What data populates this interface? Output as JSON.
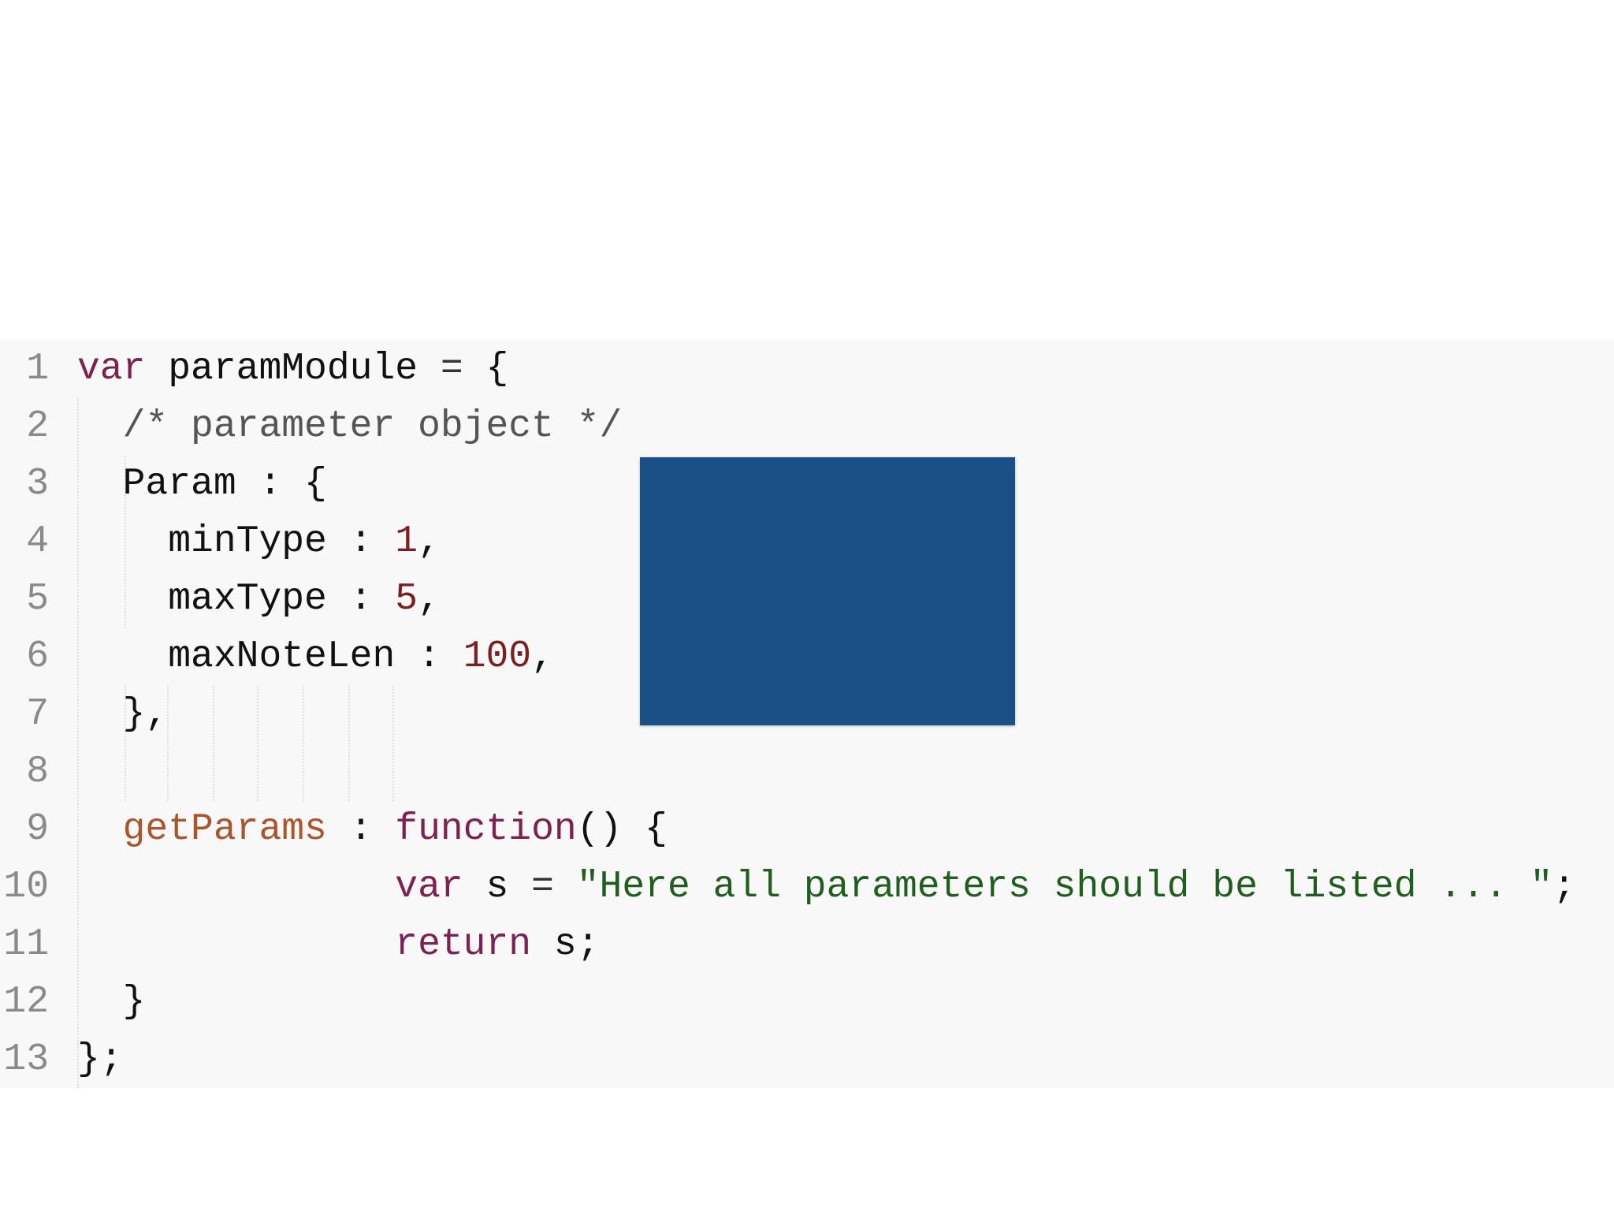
{
  "colors": {
    "background": "#ffffff",
    "editor_background": "#f8f8f8",
    "gutter_text": "#8a8a8a",
    "default_text": "#111111",
    "keyword": "#7c2150",
    "property": "#a9562e",
    "number": "#7b2020",
    "comment": "#555555",
    "string": "#1f5e1f",
    "punctuation": "#333333",
    "redaction_block": "#1a5086"
  },
  "editor": {
    "lines": [
      {
        "number": "1",
        "tokens": [
          {
            "text": "var",
            "type": "keyword"
          },
          {
            "text": " paramModule ",
            "type": "plain"
          },
          {
            "text": "=",
            "type": "punctuation"
          },
          {
            "text": " {",
            "type": "plain"
          }
        ]
      },
      {
        "number": "2",
        "tokens": [
          {
            "text": "  ",
            "type": "plain"
          },
          {
            "text": "/* parameter object */",
            "type": "comment"
          }
        ]
      },
      {
        "number": "3",
        "tokens": [
          {
            "text": "  Param : {",
            "type": "plain"
          }
        ]
      },
      {
        "number": "4",
        "tokens": [
          {
            "text": "    minType : ",
            "type": "plain"
          },
          {
            "text": "1",
            "type": "number"
          },
          {
            "text": ",",
            "type": "plain"
          }
        ]
      },
      {
        "number": "5",
        "tokens": [
          {
            "text": "    maxType : ",
            "type": "plain"
          },
          {
            "text": "5",
            "type": "number"
          },
          {
            "text": ",",
            "type": "plain"
          }
        ]
      },
      {
        "number": "6",
        "tokens": [
          {
            "text": "    maxNoteLen : ",
            "type": "plain"
          },
          {
            "text": "100",
            "type": "number"
          },
          {
            "text": ",",
            "type": "plain"
          }
        ]
      },
      {
        "number": "7",
        "tokens": [
          {
            "text": "  },",
            "type": "plain"
          }
        ]
      },
      {
        "number": "8",
        "tokens": []
      },
      {
        "number": "9",
        "tokens": [
          {
            "text": "  ",
            "type": "plain"
          },
          {
            "text": "getParams",
            "type": "property"
          },
          {
            "text": " : ",
            "type": "plain"
          },
          {
            "text": "function",
            "type": "keyword"
          },
          {
            "text": "() {",
            "type": "plain"
          }
        ]
      },
      {
        "number": "10",
        "tokens": [
          {
            "text": "              ",
            "type": "plain"
          },
          {
            "text": "var",
            "type": "keyword"
          },
          {
            "text": " s ",
            "type": "plain"
          },
          {
            "text": "=",
            "type": "punctuation"
          },
          {
            "text": " ",
            "type": "plain"
          },
          {
            "text": "\"Here all parameters should be listed ... \"",
            "type": "string"
          },
          {
            "text": ";",
            "type": "plain"
          }
        ]
      },
      {
        "number": "11",
        "tokens": [
          {
            "text": "              ",
            "type": "plain"
          },
          {
            "text": "return",
            "type": "keyword"
          },
          {
            "text": " s;",
            "type": "plain"
          }
        ]
      },
      {
        "number": "12",
        "tokens": [
          {
            "text": "  }",
            "type": "plain"
          }
        ]
      },
      {
        "number": "13",
        "tokens": [
          {
            "text": "};",
            "type": "plain"
          }
        ]
      }
    ]
  }
}
